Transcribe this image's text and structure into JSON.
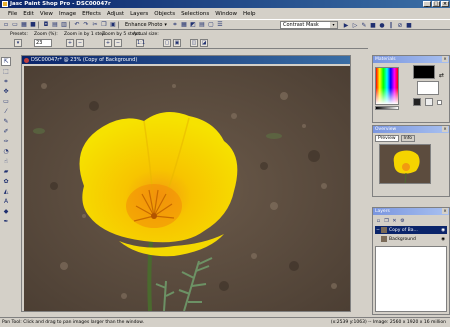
{
  "app": {
    "title": "Jasc Paint Shop Pro - DSC00047r"
  },
  "menu": [
    "File",
    "Edit",
    "View",
    "Image",
    "Effects",
    "Adjust",
    "Layers",
    "Objects",
    "Selections",
    "Window",
    "Help"
  ],
  "toolbar": {
    "enhance_label": "Enhance Photo",
    "script_select": "Contrast Mask"
  },
  "tool_options": {
    "presets_label": "Presets:",
    "zoom_pct_label": "Zoom (%):",
    "zoom_pct_value": "23",
    "zoom_in_label": "Zoom in by 1 step:",
    "zoom_out_label": "Zoom by 5 steps:",
    "actual_size_label": "Actual size:"
  },
  "document": {
    "title": "DSC00047r* @  23% (Copy of Background)"
  },
  "palettes": {
    "materials_title": "Materials",
    "overview_title": "Overview",
    "overview_tabs": [
      "Preview",
      "Info"
    ],
    "layers_title": "Layers",
    "layers": [
      {
        "name": "Copy of Ba...",
        "selected": true
      },
      {
        "name": "Background",
        "selected": false
      }
    ]
  },
  "status": {
    "left": "Pan Tool: Click and drag to pan images larger than the window.",
    "right": "(x:2539 y:1063) -- Image:  2560 x 1920 x 16 million"
  },
  "colors": {
    "foreground": "#000000",
    "background": "#ffffff",
    "flower": "#f5d800"
  }
}
